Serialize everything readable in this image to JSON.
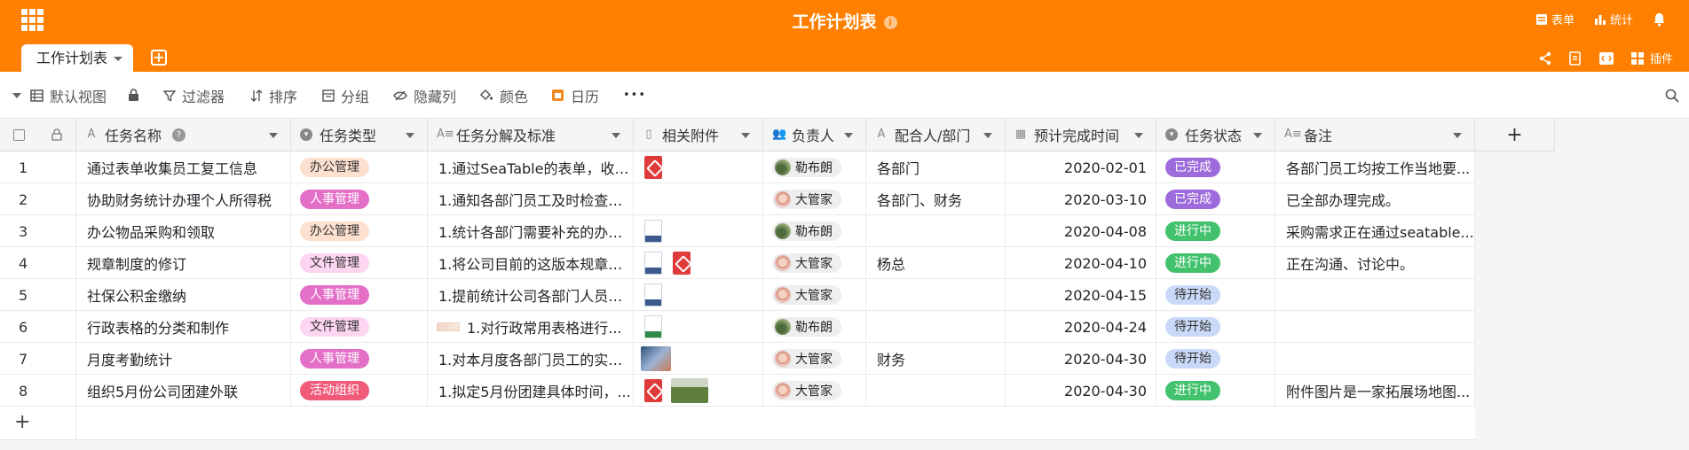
{
  "app": {
    "title": "工作计划表"
  },
  "topbar": {
    "form_label": "表单",
    "stats_label": "统计"
  },
  "tabs": [
    {
      "label": "工作计划表"
    }
  ],
  "tab_tools": {
    "plugin_label": "插件"
  },
  "toolbar": {
    "view": "默认视图",
    "filter": "过滤器",
    "sort": "排序",
    "group": "分组",
    "hide": "隐藏列",
    "color": "颜色",
    "calendar": "日历",
    "more": "•••"
  },
  "columns": [
    "任务名称",
    "任务类型",
    "任务分解及标准",
    "相关附件",
    "负责人",
    "配合人/部门",
    "预计完成时间",
    "任务状态",
    "备注"
  ],
  "colors": {
    "brand": "#ff8000",
    "type_office": "#fde0cf",
    "type_hr": "#e36fc7",
    "type_doc": "#fcd5f0",
    "type_event": "#f05b7a",
    "status_done": "#9d6bdb",
    "status_progress": "#43c26e",
    "status_pending": "#c9d9f7"
  },
  "rows": [
    {
      "no": "1",
      "name": "通过表单收集员工复工信息",
      "type": "办公管理",
      "detail": "1.通过SeaTable的表单，收集...",
      "owner": "勒布朗",
      "partner": "各部门",
      "date": "2020-02-01",
      "status": "已完成",
      "note": "各部门员工均按工作当地要..."
    },
    {
      "no": "2",
      "name": "协助财务统计办理个人所得税",
      "type": "人事管理",
      "detail": "1.通知各部门员工及时检查和...",
      "owner": "大管家",
      "partner": "各部门、财务",
      "date": "2020-03-10",
      "status": "已完成",
      "note": "已全部办理完成。"
    },
    {
      "no": "3",
      "name": "办公物品采购和领取",
      "type": "办公管理",
      "detail": "1.统计各部门需要补充的办公...",
      "owner": "勒布朗",
      "partner": "",
      "date": "2020-04-08",
      "status": "进行中",
      "note": "采购需求正在通过seatable..."
    },
    {
      "no": "4",
      "name": "规章制度的修订",
      "type": "文件管理",
      "detail": "1.将公司目前的这版本规章制...",
      "owner": "大管家",
      "partner": "杨总",
      "date": "2020-04-10",
      "status": "进行中",
      "note": "正在沟通、讨论中。"
    },
    {
      "no": "5",
      "name": "社保公积金缴纳",
      "type": "人事管理",
      "detail": "1.提前统计公司各部门人员特...",
      "owner": "大管家",
      "partner": "",
      "date": "2020-04-15",
      "status": "待开始",
      "note": ""
    },
    {
      "no": "6",
      "name": "行政表格的分类和制作",
      "type": "文件管理",
      "detail": "1.对行政常用表格进行...",
      "owner": "勒布朗",
      "partner": "",
      "date": "2020-04-24",
      "status": "待开始",
      "note": ""
    },
    {
      "no": "7",
      "name": "月度考勤统计",
      "type": "人事管理",
      "detail": "1.对本月度各部门员工的实际...",
      "owner": "大管家",
      "partner": "财务",
      "date": "2020-04-30",
      "status": "待开始",
      "note": ""
    },
    {
      "no": "8",
      "name": "组织5月份公司团建外联",
      "type": "活动组织",
      "detail": "1.拟定5月份团建具体时间，...",
      "owner": "大管家",
      "partner": "",
      "date": "2020-04-30",
      "status": "进行中",
      "note": "附件图片是一家拓展场地图..."
    }
  ],
  "add_row_label": "+"
}
